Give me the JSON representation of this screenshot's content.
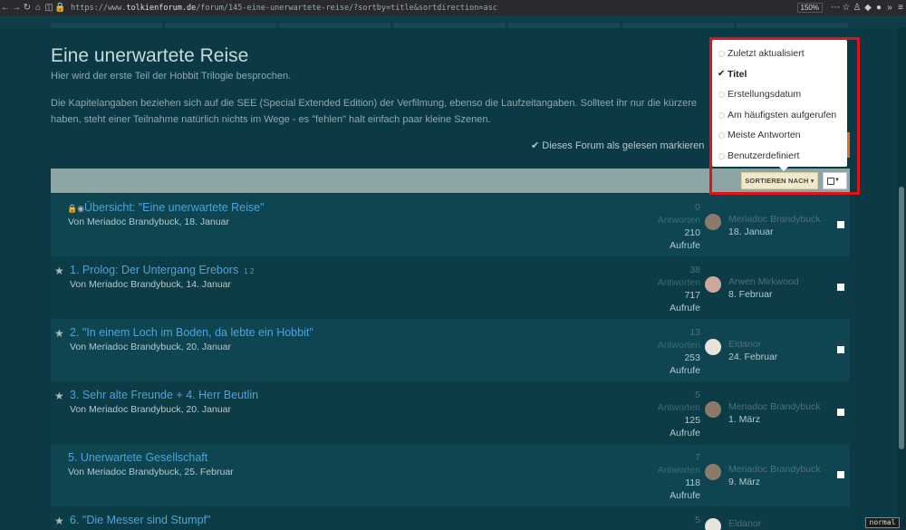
{
  "browser": {
    "url_prefix": "https://www.",
    "url_domain": "tolkienforum.de",
    "url_rest": "/forum/145-eine-unerwartete-reise/?sortby=title&sortdirection=asc",
    "zoom": "150%"
  },
  "forum": {
    "title": "Eine unerwartete Reise",
    "subtitle": "Hier wird der erste Teil der Hobbit Trilogie besprochen.",
    "description": "Die Kapitelangaben beziehen sich auf die SEE (Special Extended Edition) der Verfilmung, ebenso die Laufzeitangaben. Sollteet ihr nur die kürzere haben, steht einer Teilnahme natürlich nichts im Wege - es \"fehlen\" halt einfach paar kleine Szenen.",
    "mark_read": "Dieses Forum als gelesen markieren"
  },
  "sort_menu": {
    "items": [
      {
        "label": "Zuletzt aktualisiert",
        "selected": false
      },
      {
        "label": "Titel",
        "selected": true
      },
      {
        "label": "Erstellungsdatum",
        "selected": false
      },
      {
        "label": "Am häufigsten aufgerufen",
        "selected": false
      },
      {
        "label": "Meiste Antworten",
        "selected": false
      },
      {
        "label": "Benutzerdefiniert",
        "selected": false
      }
    ],
    "button_label": "SORTIEREN NACH ▾"
  },
  "topics": [
    {
      "title": "Übersicht: \"Eine unerwartete Reise\"",
      "pages": "",
      "by": "Von Meriadoc Brandybuck, 18. Januar",
      "replies": "0",
      "replies_label": "Antworten",
      "views": "210",
      "views_label": "Aufrufe",
      "last_user": "Meriadoc Brandybuck",
      "last_date": "18. Januar"
    },
    {
      "title": "1. Prolog: Der Untergang Erebors",
      "pages": "1  2",
      "by": "Von Meriadoc Brandybuck, 14. Januar",
      "replies": "38",
      "replies_label": "Antworten",
      "views": "717",
      "views_label": "Aufrufe",
      "last_user": "Arwen Mirkwood",
      "last_date": "8. Februar"
    },
    {
      "title": "2. \"In einem Loch im Boden, da lebte ein Hobbit\"",
      "pages": "",
      "by": "Von Meriadoc Brandybuck, 20. Januar",
      "replies": "13",
      "replies_label": "Antworten",
      "views": "253",
      "views_label": "Aufrufe",
      "last_user": "Eldanor",
      "last_date": "24. Februar"
    },
    {
      "title": "3. Sehr alte Freunde + 4. Herr Beutlin",
      "pages": "",
      "by": "Von Meriadoc Brandybuck, 20. Januar",
      "replies": "5",
      "replies_label": "Antworten",
      "views": "125",
      "views_label": "Aufrufe",
      "last_user": "Meriadoc Brandybuck",
      "last_date": "1. März"
    },
    {
      "title": "5. Unerwartete Gesellschaft",
      "pages": "",
      "by": "Von Meriadoc Brandybuck, 25. Februar",
      "replies": "7",
      "replies_label": "Antworten",
      "views": "118",
      "views_label": "Aufrufe",
      "last_user": "Meriadoc Brandybuck",
      "last_date": "9. März"
    },
    {
      "title": "6. \"Die Messer sind Stumpf\"",
      "pages": "",
      "by": "",
      "replies": "5",
      "replies_label": "",
      "views": "",
      "views_label": "",
      "last_user": "Eldanor",
      "last_date": ""
    }
  ],
  "mode_indicator": "normal"
}
